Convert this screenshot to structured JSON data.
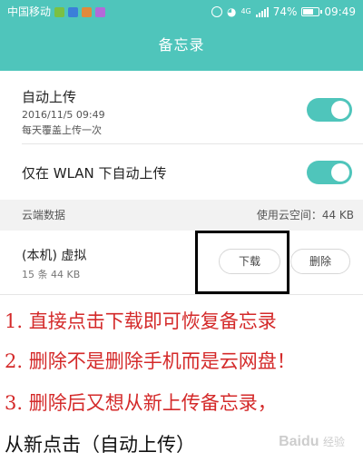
{
  "status_bar": {
    "carrier": "中国移动",
    "battery_pct_text": "74%",
    "battery_level": 0.74,
    "network": "4G",
    "time": "09:49",
    "app_icon_colors": [
      "#7bc043",
      "#3b7fd9",
      "#e08a3c",
      "#b36ad9"
    ]
  },
  "header": {
    "title": "备忘录"
  },
  "auto_upload": {
    "label": "自动上传",
    "date": "2016/11/5 09:49",
    "desc": "每天覆盖上传一次",
    "enabled": true
  },
  "wlan_only": {
    "label": "仅在 WLAN 下自动上传",
    "enabled": true
  },
  "cloud_section": {
    "title": "云端数据",
    "usage": "使用云空间：44 KB"
  },
  "device": {
    "name": "(本机) 虚拟",
    "info": "15 条 44 KB",
    "download_label": "下载",
    "delete_label": "删除"
  },
  "notes": [
    "1. 直接点击下载即可恢复备忘录",
    "2. 删除不是删除手机而是云网盘！",
    "3. 删除后又想从新上传备忘录，",
    "从新点击（自动上传）"
  ],
  "watermark": {
    "brand": "Baidu",
    "sub": "经验"
  },
  "colors": {
    "accent": "#4fc5bb",
    "annotation_red": "#d42a2a"
  }
}
